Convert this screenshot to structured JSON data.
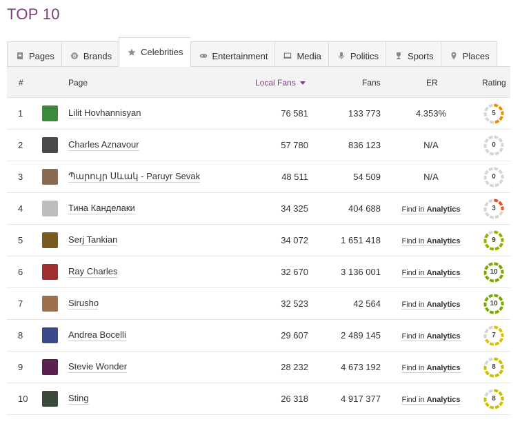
{
  "title": "TOP 10",
  "tabs": [
    {
      "label": "Pages",
      "icon": "pages-icon"
    },
    {
      "label": "Brands",
      "icon": "brand-icon"
    },
    {
      "label": "Celebrities",
      "icon": "star-icon",
      "active": true
    },
    {
      "label": "Entertainment",
      "icon": "gamepad-icon"
    },
    {
      "label": "Media",
      "icon": "monitor-icon"
    },
    {
      "label": "Politics",
      "icon": "microphone-icon"
    },
    {
      "label": "Sports",
      "icon": "trophy-icon"
    },
    {
      "label": "Places",
      "icon": "map-pin-icon"
    }
  ],
  "headers": {
    "num": "#",
    "page": "Page",
    "local_fans": "Local Fans",
    "fans": "Fans",
    "er": "ER",
    "rating": "Rating"
  },
  "find_in": "Find in",
  "analytics": "Analytics",
  "rows": [
    {
      "num": "1",
      "name": "Lilit Hovhannisyan",
      "local_fans": "76 581",
      "fans": "133 773",
      "er": "4.353%",
      "rating": "5",
      "rating_color": "#f08c00",
      "thumb_color": "#3d8a3d"
    },
    {
      "num": "2",
      "name": "Charles Aznavour",
      "local_fans": "57 780",
      "fans": "836 123",
      "er": "N/A",
      "rating": "0",
      "rating_color": "#cfcfcf",
      "thumb_color": "#4a4a4a"
    },
    {
      "num": "3",
      "name": "Պարույր Սևակ - Paruyr Sevak",
      "local_fans": "48 511",
      "fans": "54 509",
      "er": "N/A",
      "rating": "0",
      "rating_color": "#cfcfcf",
      "thumb_color": "#8a6a50"
    },
    {
      "num": "4",
      "name": "Тина Канделаки",
      "local_fans": "34 325",
      "fans": "404 688",
      "er": "",
      "rating": "3",
      "rating_color": "#e8501e",
      "thumb_color": "#bdbdbd"
    },
    {
      "num": "5",
      "name": "Serj Tankian",
      "local_fans": "34 072",
      "fans": "1 651 418",
      "er": "",
      "rating": "9",
      "rating_color": "#8cb400",
      "thumb_color": "#7a5a20"
    },
    {
      "num": "6",
      "name": "Ray Charles",
      "local_fans": "32 670",
      "fans": "3 136 001",
      "er": "",
      "rating": "10",
      "rating_color": "#7aa800",
      "thumb_color": "#a03030"
    },
    {
      "num": "7",
      "name": "Sirusho",
      "local_fans": "32 523",
      "fans": "42 564",
      "er": "",
      "rating": "10",
      "rating_color": "#7aa800",
      "thumb_color": "#a0704a"
    },
    {
      "num": "8",
      "name": "Andrea Bocelli",
      "local_fans": "29 607",
      "fans": "2 489 145",
      "er": "",
      "rating": "7",
      "rating_color": "#e0c000",
      "thumb_color": "#3a4a8a"
    },
    {
      "num": "9",
      "name": "Stevie Wonder",
      "local_fans": "28 232",
      "fans": "4 673 192",
      "er": "",
      "rating": "8",
      "rating_color": "#c8c000",
      "thumb_color": "#5a2050"
    },
    {
      "num": "10",
      "name": "Sting",
      "local_fans": "26 318",
      "fans": "4 917 377",
      "er": "",
      "rating": "8",
      "rating_color": "#c8c000",
      "thumb_color": "#3a4a3a"
    }
  ],
  "colors": {
    "accent": "#7b3d7a"
  }
}
